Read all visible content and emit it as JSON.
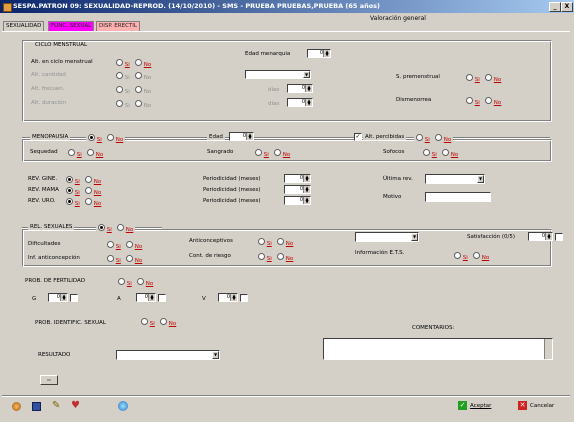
{
  "window": {
    "title": "SESPA.PATRON 09: SEXUALIDAD-REPROD. (14/10/2010) - SMS - PRUEBA PRUEBAS,PRUEBA (65 años)",
    "minimize": "_",
    "close": "X"
  },
  "header": {
    "title": "Valoración general"
  },
  "tabs": [
    {
      "label": "SEXUALIDAD"
    },
    {
      "label": "FUNC. SEXUAL"
    },
    {
      "label": "DISP. ERECTIL"
    }
  ],
  "options": {
    "si": "Si",
    "no": "No"
  },
  "ciclo": {
    "title": "CICLO MENSTRUAL",
    "edad_menarquia_label": "Edad menarquia",
    "edad_menarquia_value": "0",
    "alt_ciclo_label": "Alt. en ciclo menstrual",
    "alt_cantidad_label": "Alt. cantidad",
    "alt_frecuencia_label": "Alt. frecuen.",
    "alt_duracion_label": "Alt. duración",
    "dias_label": "días",
    "dias_1": "0",
    "dias_2": "0",
    "s_premenstrual_label": "S. premenstrual",
    "dismenorrea_label": "Dismenorrea"
  },
  "menopausia": {
    "title": "MENOPAUSIA",
    "edad_label": "Edad",
    "edad_value": "0",
    "alt_percibidas_label": "Alt. percibidas",
    "sequedad_label": "Sequedad",
    "sangrado_label": "Sangrado",
    "sofocos_label": "Sofocos"
  },
  "revisiones": {
    "gine_label": "REV. GINE.",
    "mama_label": "REV. MAMA",
    "uro_label": "REV. URO.",
    "periodicidad_label": "Periodicidad (meses)",
    "per_gine": "0",
    "per_mama": "0",
    "per_uro": "0",
    "ultima_label": "Última rev.",
    "motivo_label": "Motivo"
  },
  "relaciones": {
    "title": "REL. SEXUALES",
    "dificultades_label": "Dificultades",
    "inf_anticoncepcion_label": "Inf. anticoncepción",
    "anticonceptivos_label": "Anticonceptivos",
    "cont_riesgo_label": "Cont. de riesgo",
    "satisfaccion_label": "Satisfacción (0/5)",
    "satisfaccion_value": "0",
    "info_ets_label": "Información E.T.S."
  },
  "fertilidad": {
    "title": "PROB. DE FERTILIDAD",
    "g_label": "G",
    "g_value": "0",
    "a_label": "A",
    "a_value": "0",
    "v_label": "V",
    "v_value": "0"
  },
  "identific": {
    "label": "PROB. IDENTIFIC. SEXUAL"
  },
  "comentarios": {
    "label": "COMENTARIOS:"
  },
  "resultado": {
    "label": "RESULTADO"
  },
  "footer": {
    "aceptar": "Aceptar",
    "cancelar": "Cancelar"
  },
  "colors": {
    "title_start": "#0a246a",
    "title_end": "#a6caf0",
    "tab_func": "#ff00ff",
    "tab_disp": "#ffb0b0",
    "accent_red": "#c00000"
  }
}
